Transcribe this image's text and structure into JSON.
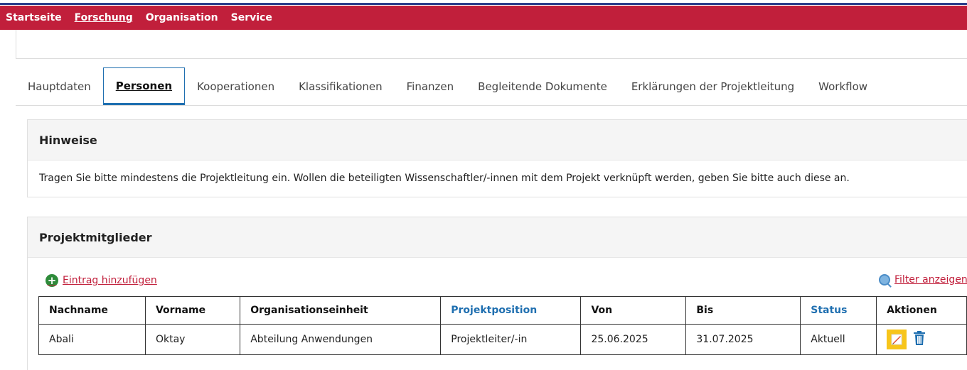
{
  "nav": {
    "items": [
      {
        "label": "Startseite",
        "active": false
      },
      {
        "label": "Forschung",
        "active": true
      },
      {
        "label": "Organisation",
        "active": false
      },
      {
        "label": "Service",
        "active": false
      }
    ]
  },
  "tabs": [
    {
      "label": "Hauptdaten",
      "active": false
    },
    {
      "label": "Personen",
      "active": true
    },
    {
      "label": "Kooperationen",
      "active": false
    },
    {
      "label": "Klassifikationen",
      "active": false
    },
    {
      "label": "Finanzen",
      "active": false
    },
    {
      "label": "Begleitende Dokumente",
      "active": false
    },
    {
      "label": "Erklärungen der Projektleitung",
      "active": false
    },
    {
      "label": "Workflow",
      "active": false
    }
  ],
  "hinweise": {
    "title": "Hinweise",
    "text": "Tragen Sie bitte mindestens die Projektleitung ein. Wollen die beteiligten Wissenschaftler/-innen mit dem Projekt verknüpft werden, geben Sie bitte auch diese an."
  },
  "mitglieder": {
    "title": "Projektmitglieder",
    "add_label": "Eintrag hinzufügen",
    "filter_label": "Filter anzeigen",
    "columns": [
      "Nachname",
      "Vorname",
      "Organisationseinheit",
      "Projektposition",
      "Von",
      "Bis",
      "Status",
      "Aktionen"
    ],
    "rows": [
      {
        "nachname": "Abali",
        "vorname": "Oktay",
        "organisationseinheit": "Abteilung Anwendungen",
        "projektposition": "Projektleiter/-in",
        "von": "25.06.2025",
        "bis": "31.07.2025",
        "status": "Aktuell"
      }
    ]
  },
  "colors": {
    "nav_bg": "#c11f3b",
    "link": "#c11f3b",
    "sortable_header": "#1f6fb0",
    "edit_highlight": "#f7c51b"
  }
}
